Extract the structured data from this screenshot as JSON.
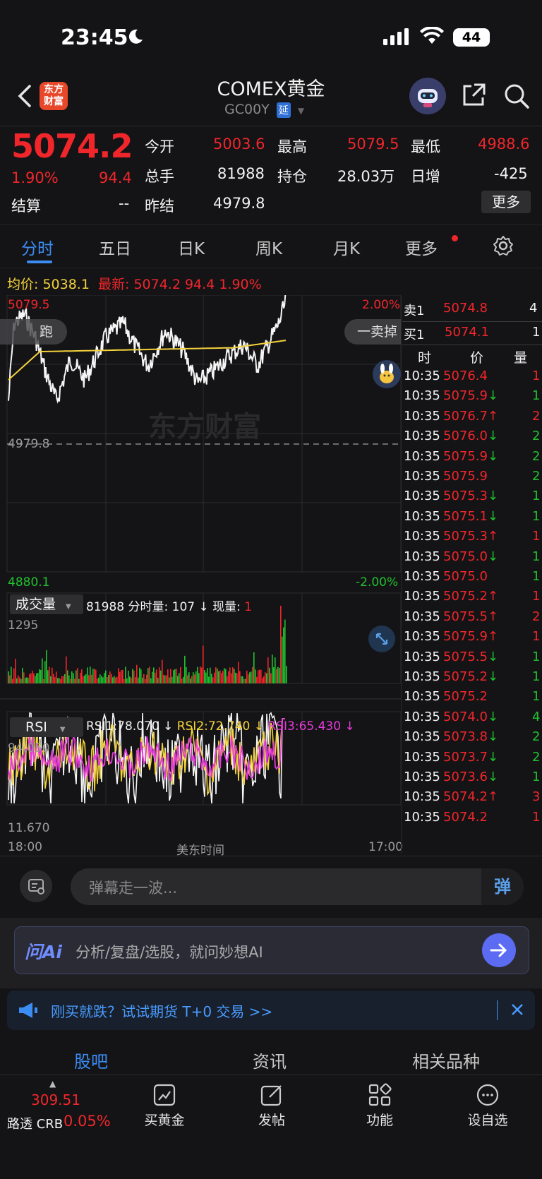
{
  "status_bar": {
    "time": "23:45",
    "battery": "44"
  },
  "header": {
    "title": "COMEX黄金",
    "code": "GC00Y",
    "delay_badge": "延"
  },
  "quote": {
    "price": "5074.2",
    "change_pct": "1.90%",
    "change": "94.4",
    "settle_label": "结算",
    "settle_value": "--",
    "open_label": "今开",
    "open_value": "5003.6",
    "high_label": "最高",
    "high_value": "5079.5",
    "low_label": "最低",
    "low_value": "4988.6",
    "volume_label": "总手",
    "volume_value": "81988",
    "oi_label": "持仓",
    "oi_value": "28.03万",
    "daily_inc_label": "日增",
    "daily_inc_value": "-425",
    "prev_settle_label": "昨结",
    "prev_settle_value": "4979.8",
    "more_button": "更多"
  },
  "tabs": [
    "分时",
    "五日",
    "日K",
    "周K",
    "月K",
    "更多"
  ],
  "intraday": {
    "avg_label": "均价:",
    "avg_value": "5038.1",
    "latest_label": "最新:",
    "latest_value": "5074.2",
    "latest_change": "94.4",
    "latest_pct": "1.90%",
    "y_top": "5079.5",
    "y_top_pct": "2.00%",
    "y_mid": "4979.8",
    "y_bottom": "4880.1",
    "y_bottom_pct": "-2.00%",
    "watermark": "东方财富",
    "left_pill": "跑",
    "right_pill": "一卖掉",
    "volume_indicator": "成交量",
    "vol_total": "81988",
    "vol_period_label": "分时量:",
    "vol_period": "107 ↓",
    "vol_now_label": "现量:",
    "vol_now": "1",
    "vol_max": "1295",
    "rsi_indicator": "RSI",
    "rsi1": "RSI1:78.070 ↓",
    "rsi2": "RSI2:72.740 ↓",
    "rsi3": "RSI3:65.430 ↓",
    "rsi_top": "94.050",
    "rsi_bottom": "11.670",
    "x_start": "18:00",
    "x_mid": "美东时间",
    "x_end": "17:00"
  },
  "orderbook": {
    "sell_label": "卖1",
    "sell_price": "5074.8",
    "sell_qty": "4",
    "buy_label": "买1",
    "buy_price": "5074.1",
    "buy_qty": "1",
    "col_time": "时",
    "col_price": "价",
    "col_qty": "量",
    "trades": [
      {
        "t": "10:35",
        "p": "5076.4",
        "d": "",
        "q": "1",
        "pc": "red",
        "qc": "red"
      },
      {
        "t": "10:35",
        "p": "5075.9",
        "d": "↓",
        "q": "1",
        "pc": "red",
        "qc": "green"
      },
      {
        "t": "10:35",
        "p": "5076.7",
        "d": "↑",
        "q": "2",
        "pc": "red",
        "qc": "red"
      },
      {
        "t": "10:35",
        "p": "5076.0",
        "d": "↓",
        "q": "2",
        "pc": "red",
        "qc": "green"
      },
      {
        "t": "10:35",
        "p": "5075.9",
        "d": "↓",
        "q": "2",
        "pc": "red",
        "qc": "green"
      },
      {
        "t": "10:35",
        "p": "5075.9",
        "d": "",
        "q": "2",
        "pc": "red",
        "qc": "green"
      },
      {
        "t": "10:35",
        "p": "5075.3",
        "d": "↓",
        "q": "1",
        "pc": "red",
        "qc": "green"
      },
      {
        "t": "10:35",
        "p": "5075.1",
        "d": "↓",
        "q": "1",
        "pc": "red",
        "qc": "green"
      },
      {
        "t": "10:35",
        "p": "5075.3",
        "d": "↑",
        "q": "1",
        "pc": "red",
        "qc": "red"
      },
      {
        "t": "10:35",
        "p": "5075.0",
        "d": "↓",
        "q": "1",
        "pc": "red",
        "qc": "green"
      },
      {
        "t": "10:35",
        "p": "5075.0",
        "d": "",
        "q": "1",
        "pc": "red",
        "qc": "green"
      },
      {
        "t": "10:35",
        "p": "5075.2",
        "d": "↑",
        "q": "1",
        "pc": "red",
        "qc": "red"
      },
      {
        "t": "10:35",
        "p": "5075.5",
        "d": "↑",
        "q": "2",
        "pc": "red",
        "qc": "red"
      },
      {
        "t": "10:35",
        "p": "5075.9",
        "d": "↑",
        "q": "1",
        "pc": "red",
        "qc": "red"
      },
      {
        "t": "10:35",
        "p": "5075.5",
        "d": "↓",
        "q": "1",
        "pc": "red",
        "qc": "green"
      },
      {
        "t": "10:35",
        "p": "5075.2",
        "d": "↓",
        "q": "1",
        "pc": "red",
        "qc": "green"
      },
      {
        "t": "10:35",
        "p": "5075.2",
        "d": "",
        "q": "1",
        "pc": "red",
        "qc": "green"
      },
      {
        "t": "10:35",
        "p": "5074.0",
        "d": "↓",
        "q": "4",
        "pc": "red",
        "qc": "green"
      },
      {
        "t": "10:35",
        "p": "5073.8",
        "d": "↓",
        "q": "2",
        "pc": "red",
        "qc": "green"
      },
      {
        "t": "10:35",
        "p": "5073.7",
        "d": "↓",
        "q": "2",
        "pc": "red",
        "qc": "green"
      },
      {
        "t": "10:35",
        "p": "5073.6",
        "d": "↓",
        "q": "1",
        "pc": "red",
        "qc": "green"
      },
      {
        "t": "10:35",
        "p": "5074.2",
        "d": "↑",
        "q": "3",
        "pc": "red",
        "qc": "red"
      },
      {
        "t": "10:35",
        "p": "5074.2",
        "d": "",
        "q": "1",
        "pc": "red",
        "qc": "red"
      }
    ]
  },
  "danmaku": {
    "placeholder": "弹幕走一波...",
    "button": "弹"
  },
  "ai_bar": {
    "logo": "问Ai",
    "placeholder": "分析/复盘/选股，就问妙想AI"
  },
  "promo": {
    "text": "刚买就跌？试试期货 T+0 交易 >>"
  },
  "section_tabs": [
    "股吧",
    "资讯",
    "相关品种"
  ],
  "bottom_bar": {
    "index_value": "309.51",
    "index_name": "路透 CRB",
    "index_pct": "0.05%",
    "buy_gold": "买黄金",
    "post": "发帖",
    "functions": "功能",
    "add_watch": "设自选"
  },
  "colors": {
    "up": "#f0262b",
    "down": "#21c12f",
    "accent": "#3b8cf3",
    "avg": "#f4d23b",
    "rsi3": "#e53ad9"
  }
}
